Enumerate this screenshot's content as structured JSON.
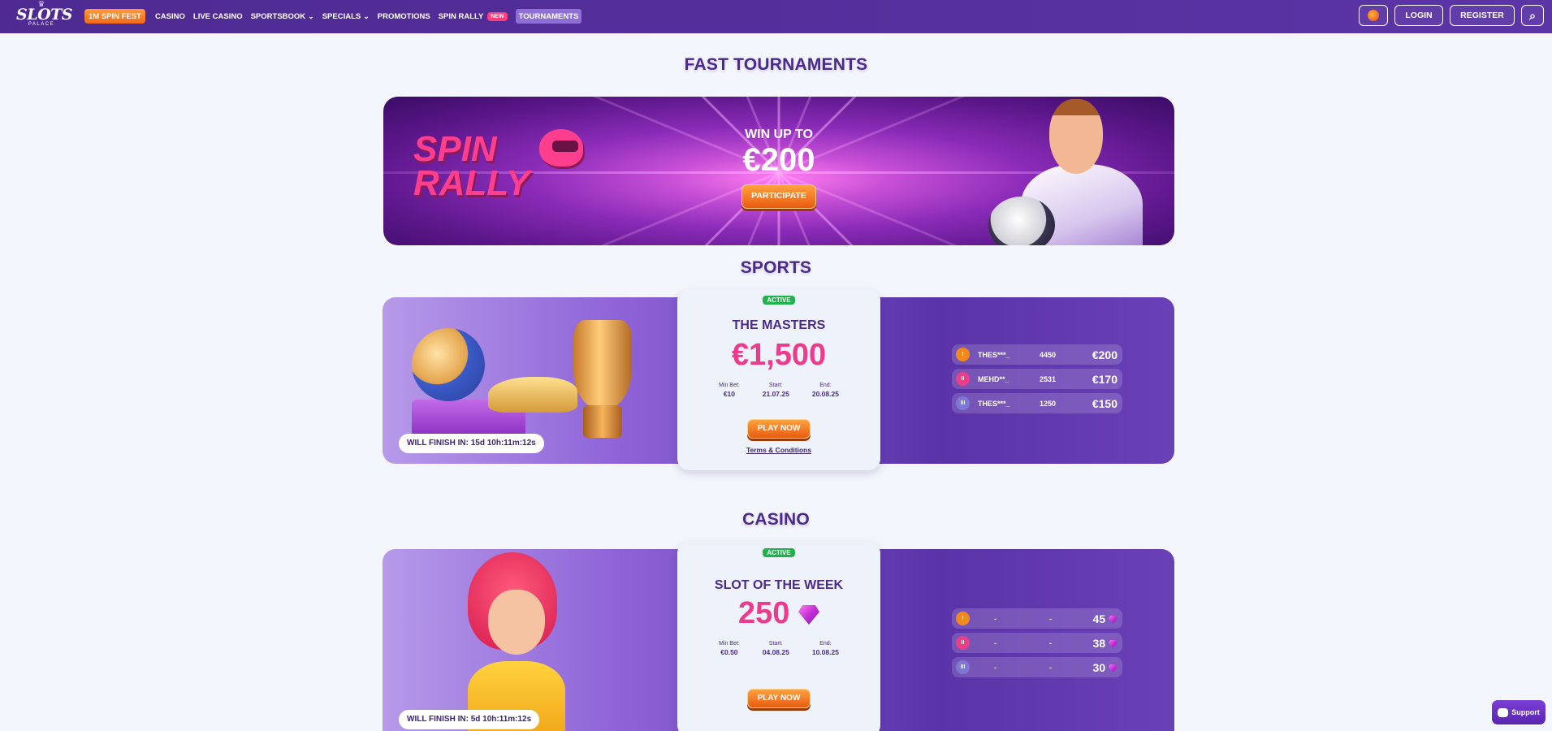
{
  "nav": {
    "logo_text": "SLOTS",
    "logo_sub": "PALACE",
    "items": [
      {
        "label": "1M SPIN FEST",
        "kind": "promo"
      },
      {
        "label": "CASINO",
        "kind": "link"
      },
      {
        "label": "LIVE CASINO",
        "kind": "link"
      },
      {
        "label": "SPORTSBOOK",
        "kind": "dropdown"
      },
      {
        "label": "SPECIALS",
        "kind": "dropdown"
      },
      {
        "label": "PROMOTIONS",
        "kind": "link"
      },
      {
        "label": "SPIN RALLY",
        "kind": "link",
        "badge": "NEW"
      },
      {
        "label": "TOURNAMENTS",
        "kind": "active"
      }
    ],
    "login_label": "LOGIN",
    "register_label": "REGISTER"
  },
  "fast": {
    "title": "FAST TOURNAMENTS",
    "banner_line1": "SPIN",
    "banner_line2": "RALLY",
    "win_up_to": "WIN UP TO",
    "amount": "€200",
    "cta": "PARTICIPATE"
  },
  "sports": {
    "title": "SPORTS",
    "status": "ACTIVE",
    "name": "THE MASTERS",
    "prize": "€1,500",
    "min_bet_label": "Min Bet:",
    "min_bet": "€10",
    "start_label": "Start:",
    "start": "21.07.25",
    "end_label": "End:",
    "end": "20.08.25",
    "cta": "PLAY NOW",
    "terms": "Terms & Conditions",
    "finish": "WILL FINISH IN: 15d 10h:11m:12s",
    "leaders": [
      {
        "rank": "I",
        "name": "THES***_",
        "points": "4450",
        "prize": "€200"
      },
      {
        "rank": "II",
        "name": "MEHD**_",
        "points": "2531",
        "prize": "€170"
      },
      {
        "rank": "III",
        "name": "THES***_",
        "points": "1250",
        "prize": "€150"
      }
    ]
  },
  "casino": {
    "title": "CASINO",
    "status": "ACTIVE",
    "name": "SLOT OF THE WEEK",
    "prize": "250",
    "min_bet_label": "Min Bet:",
    "min_bet": "€0.50",
    "start_label": "Start:",
    "start": "04.08.25",
    "end_label": "End:",
    "end": "10.08.25",
    "cta": "PLAY NOW",
    "finish": "WILL FINISH IN: 5d 10h:11m:12s",
    "leaders": [
      {
        "rank": "I",
        "name": "-",
        "points": "-",
        "prize": "45"
      },
      {
        "rank": "II",
        "name": "-",
        "points": "-",
        "prize": "38"
      },
      {
        "rank": "III",
        "name": "-",
        "points": "-",
        "prize": "30"
      }
    ]
  },
  "support": {
    "label": "Support"
  },
  "colors": {
    "nav": "#4e2a92",
    "accent_pink": "#ee3a8c",
    "cta_orange": "#f06a1a",
    "active_green": "#22b24c"
  }
}
